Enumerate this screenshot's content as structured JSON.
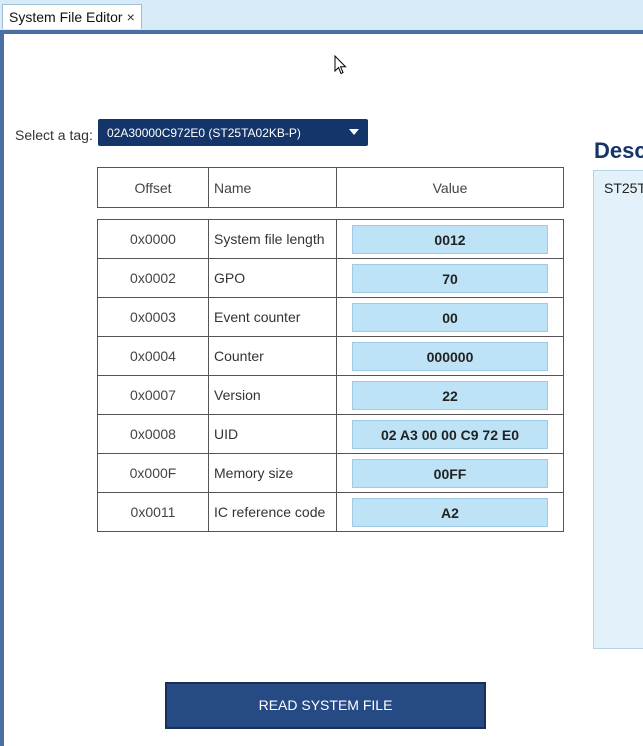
{
  "tab": {
    "title": "System File Editor",
    "close_glyph": "×"
  },
  "tag_selector": {
    "label": "Select a tag:",
    "selected": "02A30000C972E0 (ST25TA02KB-P)"
  },
  "table": {
    "headers": {
      "offset": "Offset",
      "name": "Name",
      "value": "Value"
    },
    "rows": [
      {
        "offset": "0x0000",
        "name": "System file length",
        "value": "0012"
      },
      {
        "offset": "0x0002",
        "name": "GPO",
        "value": "70"
      },
      {
        "offset": "0x0003",
        "name": "Event counter",
        "value": "00"
      },
      {
        "offset": "0x0004",
        "name": "Counter",
        "value": "000000"
      },
      {
        "offset": "0x0007",
        "name": "Version",
        "value": "22"
      },
      {
        "offset": "0x0008",
        "name": "UID",
        "value": "02 A3 00 00 C9 72 E0"
      },
      {
        "offset": "0x000F",
        "name": "Memory size",
        "value": "00FF"
      },
      {
        "offset": "0x0011",
        "name": "IC reference code",
        "value": "A2"
      }
    ]
  },
  "description": {
    "title": "Desc",
    "text": "ST25T"
  },
  "actions": {
    "read_label": "READ SYSTEM FILE"
  },
  "colors": {
    "accent": "#4a6fa3",
    "dropdown_bg": "#14356a",
    "value_bg": "#bfe3f6",
    "button_bg": "#254a84"
  }
}
